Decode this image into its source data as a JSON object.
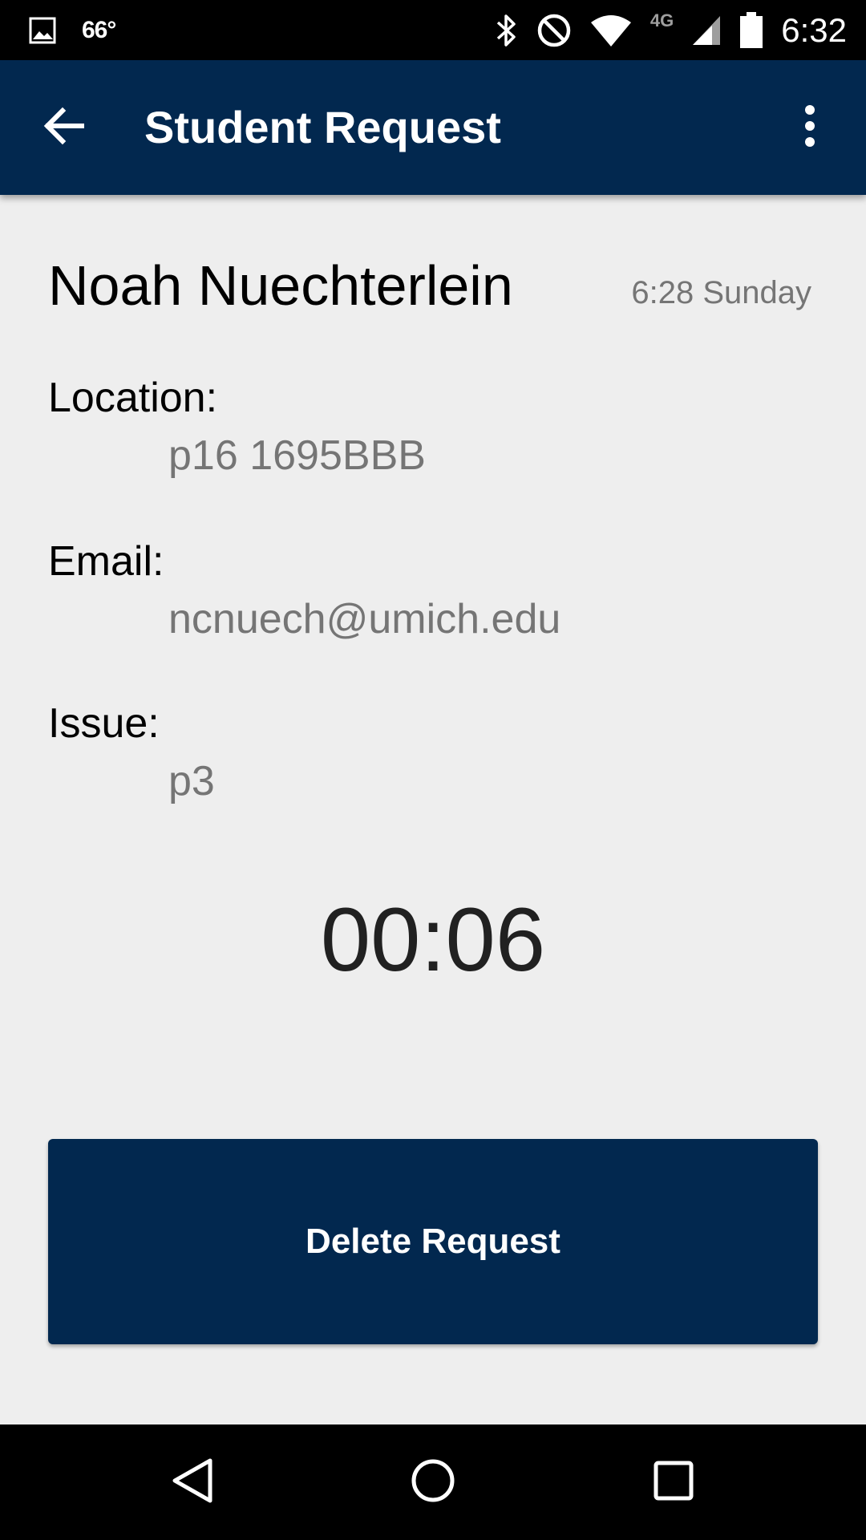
{
  "status_bar": {
    "temperature": "66°",
    "network": "4G",
    "time": "6:32",
    "icons": [
      "image-icon",
      "bluetooth-icon",
      "do-not-disturb-icon",
      "wifi-icon",
      "signal-icon",
      "battery-icon"
    ]
  },
  "app_bar": {
    "title": "Student Request",
    "icons": [
      "back-arrow-icon",
      "more-vert-icon"
    ]
  },
  "request": {
    "student_name": "Noah Nuechterlein",
    "time": "6:28 Sunday",
    "location_label": "Location:",
    "location_value": "p16 1695BBB",
    "email_label": "Email:",
    "email_value": "ncnuech@umich.edu",
    "issue_label": "Issue:",
    "issue_value": "p3",
    "timer": "00:06"
  },
  "actions": {
    "delete_label": "Delete Request"
  },
  "nav_bar": {
    "icons": [
      "back-triangle-icon",
      "home-circle-icon",
      "recents-square-icon"
    ]
  },
  "colors": {
    "primary": "#02284f",
    "background": "#eeeeee",
    "secondary_text": "#757575"
  }
}
